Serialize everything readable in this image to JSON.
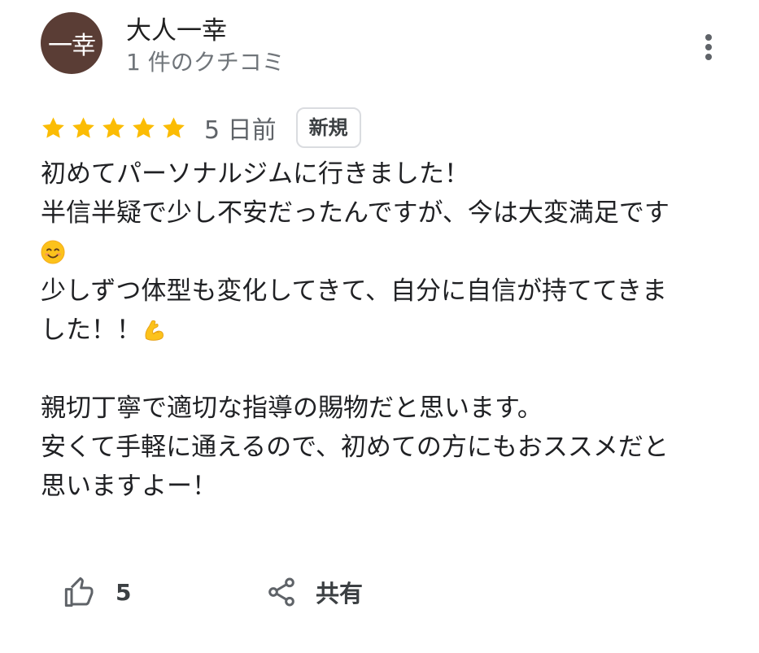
{
  "reviewer": {
    "avatar_text": "一幸",
    "name": "大人一幸",
    "review_count": "1 件のクチコミ"
  },
  "rating": {
    "stars": 5,
    "date": "5 日前",
    "badge": "新規"
  },
  "review": {
    "line1": "初めてパーソナルジムに行きました！",
    "line2": "半信半疑で少し不安だったんですが、今は大変満足です",
    "line3_emoji": "smiling-face-emoji",
    "line4": "少しずつ体型も変化してきて、自分に自信が持ててきま",
    "line5": "した！！",
    "line5_emoji": "flexed-biceps-emoji",
    "line7": "親切丁寧で適切な指導の賜物だと思います。",
    "line8": "安くて手軽に通えるので、初めての方にもおススメだと",
    "line9": "思いますよー！"
  },
  "actions": {
    "like_icon": "thumbs-up-icon",
    "like_count": "5",
    "share_icon": "share-icon",
    "share_label": "共有"
  },
  "colors": {
    "avatar_bg": "#5a3d35",
    "star": "#fbbc04",
    "secondary_text": "#70757a"
  }
}
